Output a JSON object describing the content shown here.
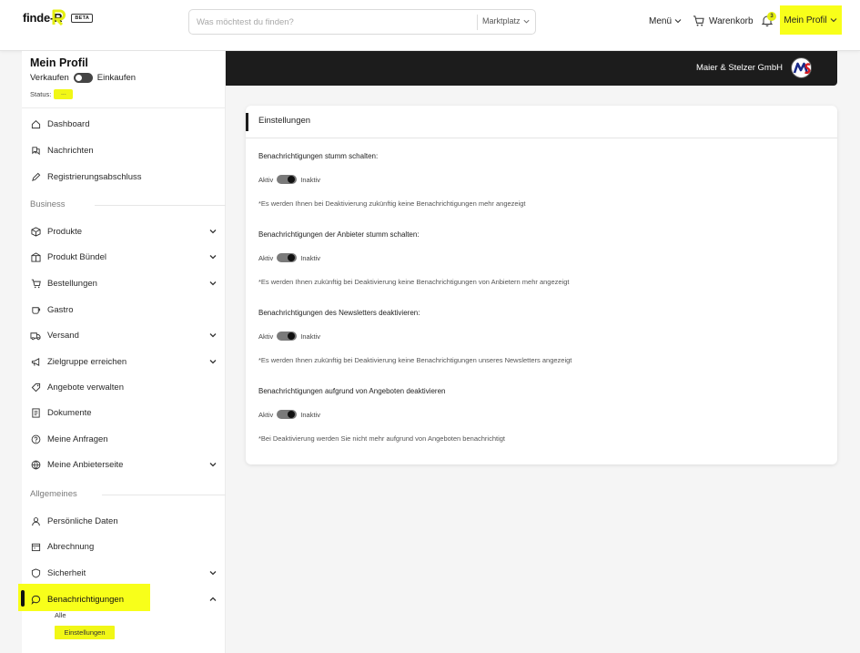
{
  "header": {
    "logo_text": "finde-R",
    "beta": "BETA",
    "search_placeholder": "Was möchtest du finden?",
    "search_scope": "Marktplatz",
    "menu": "Menü",
    "cart": "Warenkorb",
    "notification_count": "3",
    "profile": "Mein Profil",
    "accent": "#f8ff1a"
  },
  "sidebar": {
    "title": "Mein Profil",
    "sell": "Verkaufen",
    "buy": "Einkaufen",
    "status_label": "Status:",
    "status_value": "...",
    "items_top": [
      {
        "label": "Dashboard",
        "icon": "home-icon"
      },
      {
        "label": "Nachrichten",
        "icon": "chat-icon"
      },
      {
        "label": "Registrierungsabschluss",
        "icon": "pen-icon"
      }
    ],
    "section_business": "Business",
    "items_business": [
      {
        "label": "Produkte",
        "icon": "box-icon",
        "expandable": true
      },
      {
        "label": "Produkt Bündel",
        "icon": "bundle-icon",
        "expandable": true
      },
      {
        "label": "Bestellungen",
        "icon": "cart-icon",
        "expandable": true
      },
      {
        "label": "Gastro",
        "icon": "cup-icon",
        "expandable": false
      },
      {
        "label": "Versand",
        "icon": "truck-icon",
        "expandable": true
      },
      {
        "label": "Zielgruppe erreichen",
        "icon": "megaphone-icon",
        "expandable": true
      },
      {
        "label": "Angebote verwalten",
        "icon": "tag-icon",
        "expandable": false
      },
      {
        "label": "Dokumente",
        "icon": "document-icon",
        "expandable": false
      },
      {
        "label": "Meine Anfragen",
        "icon": "question-icon",
        "expandable": false
      },
      {
        "label": "Meine Anbieterseite",
        "icon": "globe-icon",
        "expandable": true
      }
    ],
    "section_general": "Allgemeines",
    "items_general": [
      {
        "label": "Persönliche Daten",
        "icon": "user-icon",
        "expandable": false
      },
      {
        "label": "Abrechnung",
        "icon": "wallet-icon",
        "expandable": false
      },
      {
        "label": "Sicherheit",
        "icon": "shield-icon",
        "expandable": true
      },
      {
        "label": "Benachrichtigungen",
        "icon": "bubble-icon",
        "expandable": true
      }
    ],
    "sub_all": "Alle",
    "sub_settings": "Einstellungen"
  },
  "banner": {
    "company": "Maier & Stelzer GmbH",
    "logo_text": "MS"
  },
  "card": {
    "title": "Einstellungen",
    "on_label": "Aktiv",
    "off_label": "Inaktiv",
    "settings": [
      {
        "label": "Benachrichtigungen stumm schalten:",
        "note": "*Es werden Ihnen bei Deaktivierung zukünftig keine Benachrichtigungen mehr angezeigt"
      },
      {
        "label": "Benachrichtigungen der Anbieter stumm schalten:",
        "note": "*Es werden Ihnen zukünftig bei Deaktivierung keine Benachrichtigungen von Anbietern mehr angezeigt"
      },
      {
        "label": "Benachrichtigungen des Newsletters deaktivieren:",
        "note": "*Es werden Ihnen zukünftig bei Deaktivierung keine Benachrichtigungen unseres Newsletters angezeigt"
      },
      {
        "label": "Benachrichtigungen aufgrund von Angeboten deaktivieren",
        "note": "*Bei Deaktivierung werden Sie nicht mehr aufgrund von Angeboten benachrichtigt"
      }
    ]
  }
}
